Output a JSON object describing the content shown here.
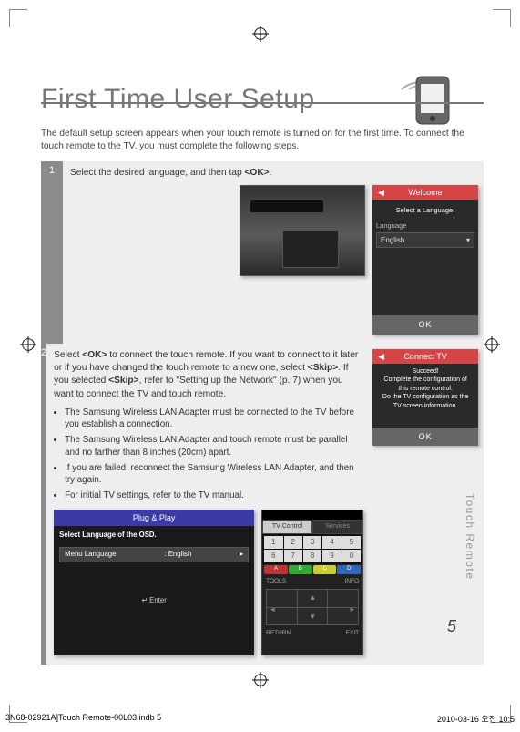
{
  "title": "First Time User Setup",
  "intro": "The default setup screen appears when your touch remote is turned on for the first time. To connect the touch remote to the TV, you must complete the following steps.",
  "step1": {
    "num": "1",
    "text_prefix": "Select the desired language, and then tap ",
    "ok_tag": "<OK>",
    "suffix": ".",
    "welcome": {
      "title": "Welcome",
      "subtitle": "Select a Language.",
      "lang_label": "Language",
      "lang_value": "English",
      "ok": "OK"
    }
  },
  "step2": {
    "num": "2",
    "p1": "Select <OK> to connect the touch remote. If you want to connect to it later or if you have changed the touch remote to a new one, select <Skip>. If you selected <Skip>, refer to \"Setting up the Network\" (p. 7) when you want to connect the TV and touch remote.",
    "bullets": [
      "The Samsung Wireless LAN Adapter must be connected to the TV before you establish a connection.",
      "The Samsung Wireless LAN Adapter and touch remote must be parallel and no farther than 8 inches (20cm) apart.",
      "If you are failed, reconnect the Samsung Wireless LAN Adapter, and then try again.",
      "For initial TV settings, refer to the TV manual."
    ],
    "connect": {
      "title": "Connect TV",
      "l1": "Succeed!",
      "l2": "Complete the configuration of this remote control.",
      "l3": "Do the TV configuration as the TV screen information.",
      "ok": "OK"
    },
    "plugplay": {
      "title": "Plug & Play",
      "sub": "Select Language of the OSD.",
      "menu_label": "Menu Language",
      "menu_value": ": English",
      "enter": "Enter"
    },
    "remote": {
      "tab_active": "TV Control",
      "tab_inactive": "Services",
      "nums": [
        "1",
        "2",
        "3",
        "4",
        "5",
        "6",
        "7",
        "8",
        "9",
        "0"
      ],
      "letters": [
        "A",
        "B",
        "C",
        "D"
      ],
      "tools": "TOOLS",
      "info": "INFO",
      "ret": "RETURN",
      "exit": "EXIT"
    }
  },
  "side_label": "Touch Remote",
  "page_number": "5",
  "footer": {
    "left": "3N68-02921A]Touch Remote-00L03.indb   5",
    "right": "2010-03-16   오전 10:5"
  }
}
